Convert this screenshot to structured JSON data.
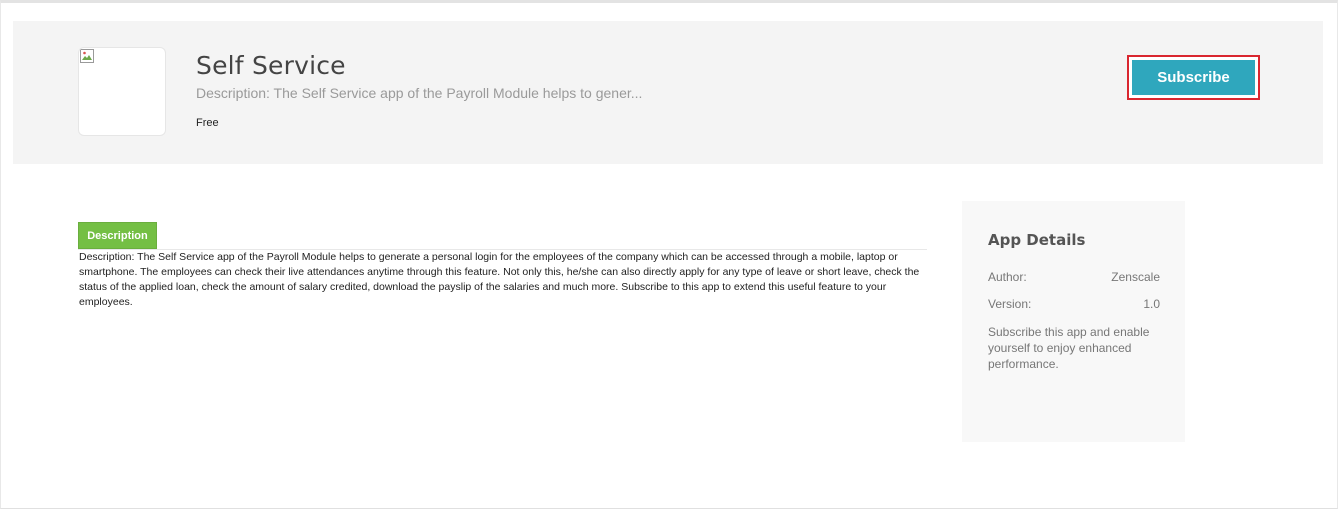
{
  "app": {
    "title": "Self Service",
    "short_description": "Description: The Self Service app of the Payroll Module helps to gener...",
    "price": "Free",
    "logo_icon": "broken-image-icon"
  },
  "actions": {
    "subscribe_label": "Subscribe"
  },
  "tabs": [
    {
      "label": "Description",
      "active": true
    }
  ],
  "description": {
    "text": "Description: The Self Service app of the Payroll Module helps to generate a personal login for the employees of the company which can be accessed through a mobile, laptop or smartphone. The employees can check their live attendances anytime through this feature. Not only this, he/she can also directly apply for any type of leave or short leave, check the status of the applied loan, check the amount of salary credited, download the payslip of the salaries and much more. Subscribe to this app to extend this useful feature to your employees."
  },
  "app_details": {
    "title": "App Details",
    "rows": [
      {
        "label": "Author:",
        "value": "Zenscale"
      },
      {
        "label": "Version:",
        "value": "1.0"
      }
    ],
    "note": "Subscribe this app and enable yourself to enjoy enhanced performance."
  },
  "colors": {
    "subscribe_bg": "#2fa7bd",
    "subscribe_highlight": "#d9262f",
    "tab_active_bg": "#74bf44"
  }
}
